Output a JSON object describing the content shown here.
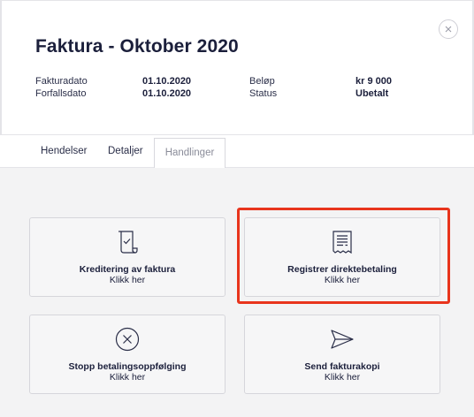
{
  "header": {
    "title": "Faktura - Oktober 2020",
    "close_icon": "close-icon",
    "fields": [
      {
        "label": "Fakturadato",
        "value": "01.10.2020"
      },
      {
        "label": "Forfallsdato",
        "value": "01.10.2020"
      },
      {
        "label": "Beløp",
        "value": "kr 9 000"
      },
      {
        "label": "Status",
        "value": "Ubetalt"
      }
    ]
  },
  "tabs": [
    {
      "label": "Hendelser"
    },
    {
      "label": "Detaljer"
    },
    {
      "label": "Handlinger",
      "active": true
    }
  ],
  "actions": [
    {
      "label": "Kreditering av faktura",
      "sub": "Klikk her",
      "icon": "receipt-check-icon"
    },
    {
      "label": "Registrer direktebetaling",
      "sub": "Klikk her",
      "icon": "invoice-document-icon",
      "highlighted": true
    },
    {
      "label": "Stopp betalingsoppfølging",
      "sub": "Klikk her",
      "icon": "circle-x-icon"
    },
    {
      "label": "Send fakturakopi",
      "sub": "Klikk her",
      "icon": "send-icon"
    }
  ],
  "colors": {
    "text": "#1b1f3b",
    "background": "#f3f3f4",
    "highlight": "#e8341c"
  }
}
